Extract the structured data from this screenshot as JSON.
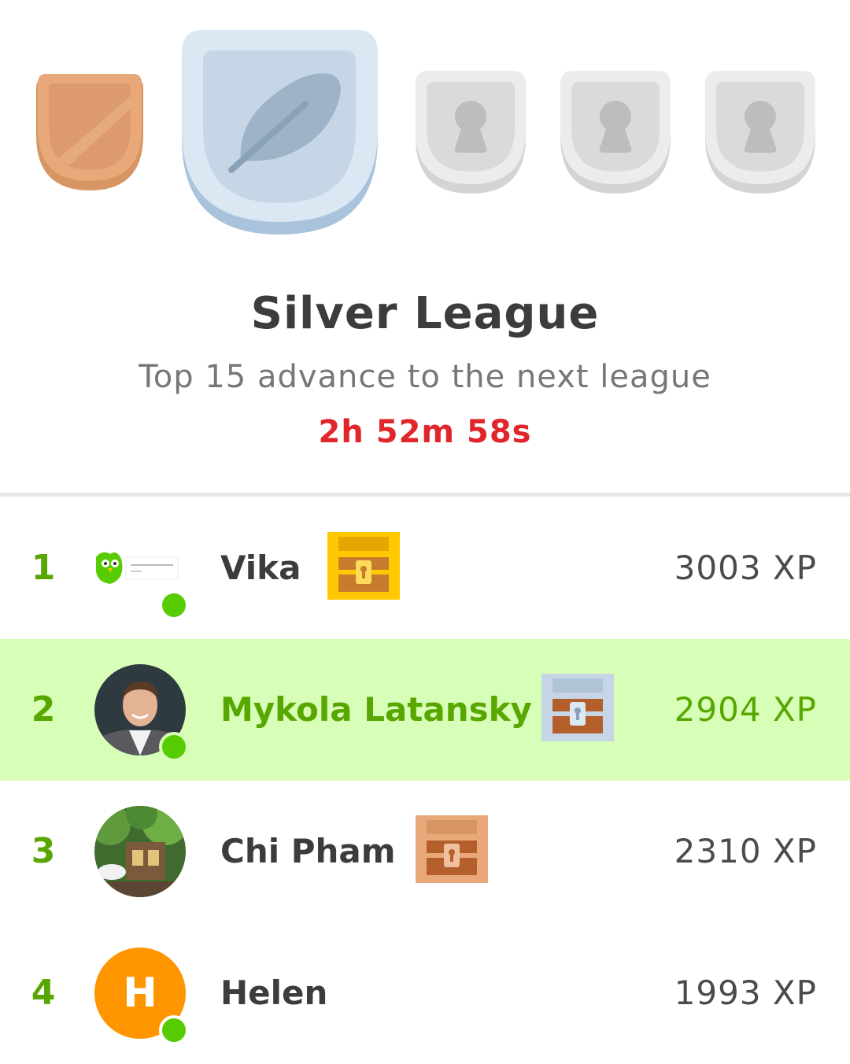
{
  "league": {
    "title": "Silver League",
    "subtitle": "Top 15 advance to the next league",
    "timer": "2h 52m 58s"
  },
  "badges": [
    {
      "name": "bronze",
      "state": "completed",
      "color": "#e8a87a"
    },
    {
      "name": "silver",
      "state": "current",
      "color": "#c9d8e6",
      "icon": "feather-icon"
    },
    {
      "name": "locked-1",
      "state": "locked",
      "icon": "keyhole-icon"
    },
    {
      "name": "locked-2",
      "state": "locked",
      "icon": "keyhole-icon"
    },
    {
      "name": "locked-3",
      "state": "locked",
      "icon": "keyhole-icon"
    }
  ],
  "leaderboard": [
    {
      "rank": "1",
      "name": "Vika",
      "xp": "3003 XP",
      "online": true,
      "chest": "gold",
      "avatar": "owl-image"
    },
    {
      "rank": "2",
      "name": "Mykola Latansky",
      "xp": "2904 XP",
      "online": true,
      "chest": "silver",
      "avatar": "photo",
      "is_current_user": true
    },
    {
      "rank": "3",
      "name": "Chi Pham",
      "xp": "2310 XP",
      "online": false,
      "chest": "bronze",
      "avatar": "photo"
    },
    {
      "rank": "4",
      "name": "Helen",
      "xp": "1993 XP",
      "online": true,
      "chest": "",
      "avatar": "letter",
      "avatar_letter": "H",
      "avatar_color": "#ff9600"
    }
  ],
  "colors": {
    "rank_green": "#58a700",
    "highlight_bg": "#d7ffb8",
    "timer_red": "#e0262a",
    "online_green": "#58cc02"
  }
}
